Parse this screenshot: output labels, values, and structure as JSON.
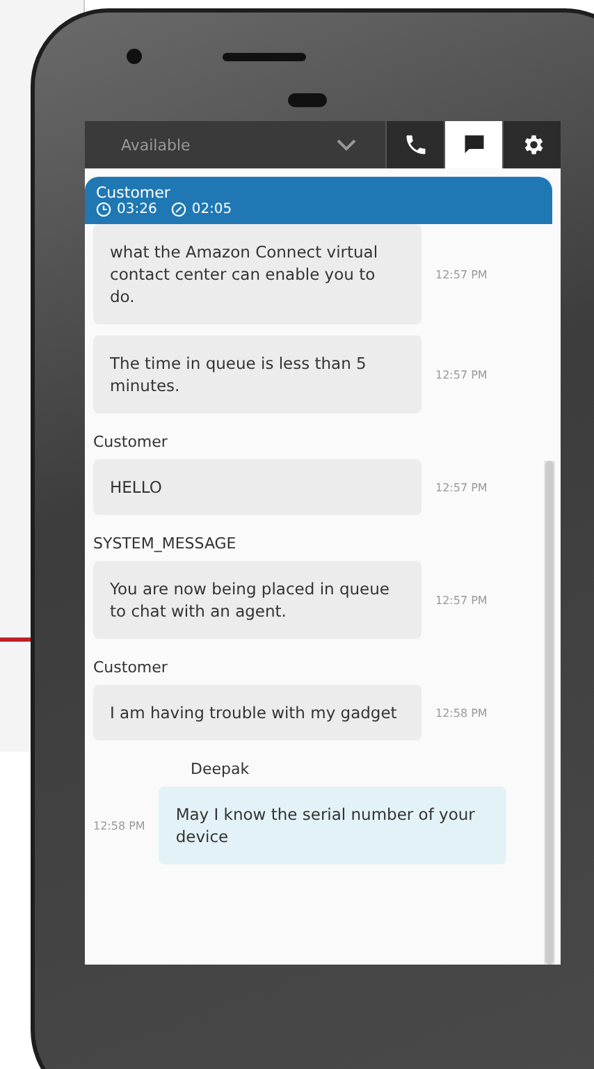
{
  "status_dropdown": {
    "value": "Available"
  },
  "tabs": [
    {
      "kind": "phone",
      "selected": false
    },
    {
      "kind": "chat",
      "selected": true
    },
    {
      "kind": "settings",
      "selected": false
    }
  ],
  "contact": {
    "name": "Customer",
    "elapsed": "03:26",
    "waiting": "02:05"
  },
  "messages": [
    {
      "kind": "customer",
      "text": "what the Amazon Connect virtual contact center can enable you to do.",
      "time": "12:57 PM"
    },
    {
      "kind": "customer",
      "text": "The time in queue is less than 5 minutes.",
      "time": "12:57 PM"
    },
    {
      "kind": "customer",
      "sender": "Customer",
      "text": "HELLO",
      "time": "12:57 PM"
    },
    {
      "kind": "customer",
      "sender": "SYSTEM_MESSAGE",
      "text": "You are now being placed in queue to chat with an agent.",
      "time": "12:57 PM"
    },
    {
      "kind": "customer",
      "sender": "Customer",
      "text": "I am having trouble with my gadget",
      "time": "12:58 PM"
    },
    {
      "kind": "agent",
      "sender": "Deepak",
      "text": "May I know the serial number of your device",
      "time": "12:58 PM"
    }
  ]
}
